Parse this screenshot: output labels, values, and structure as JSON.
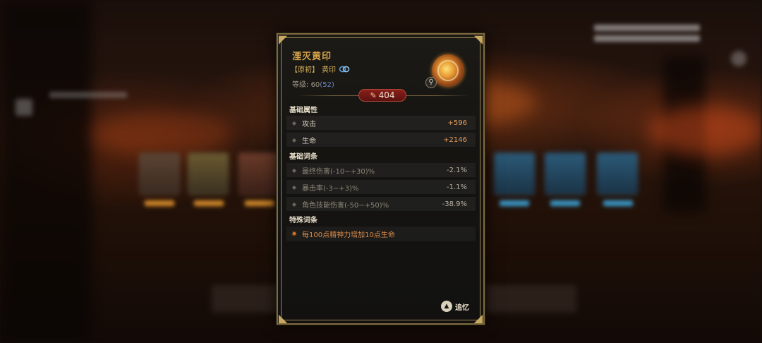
{
  "item": {
    "name": "湮灭黄印",
    "rarity_tag": "【原初】",
    "type": "黄印",
    "level_label": "等级:",
    "level": "60",
    "level_extra": "(52)",
    "score": "404"
  },
  "sections": {
    "base_attributes_title": "基础属性",
    "base_affixes_title": "基础词条",
    "special_affixes_title": "特殊词条"
  },
  "base_attributes": [
    {
      "label": "攻击",
      "value": "+596"
    },
    {
      "label": "生命",
      "value": "+2146"
    }
  ],
  "base_affixes": [
    {
      "label": "最终伤害(-10~+30)%",
      "value": "-2.1%"
    },
    {
      "label": "暴击率(-3~+3)%",
      "value": "-1.1%"
    },
    {
      "label": "角色技能伤害(-50~+50)%",
      "value": "-38.9%"
    }
  ],
  "special_affixes": [
    {
      "label": "每100点精神力增加10点生命"
    }
  ],
  "actions": {
    "recall_label": "追忆",
    "recall_button_glyph": "▲"
  },
  "icons": {
    "link": "link-icon",
    "magnify": "magnify-icon",
    "feather": "feather-icon",
    "emblem": "item-emblem-icon"
  },
  "colors": {
    "title": "#d8a54a",
    "bonus_value": "#e29a5b",
    "special_text": "#d98a4a",
    "score_badge": "#8a1f1a",
    "frame_gold": "#9c8450"
  }
}
